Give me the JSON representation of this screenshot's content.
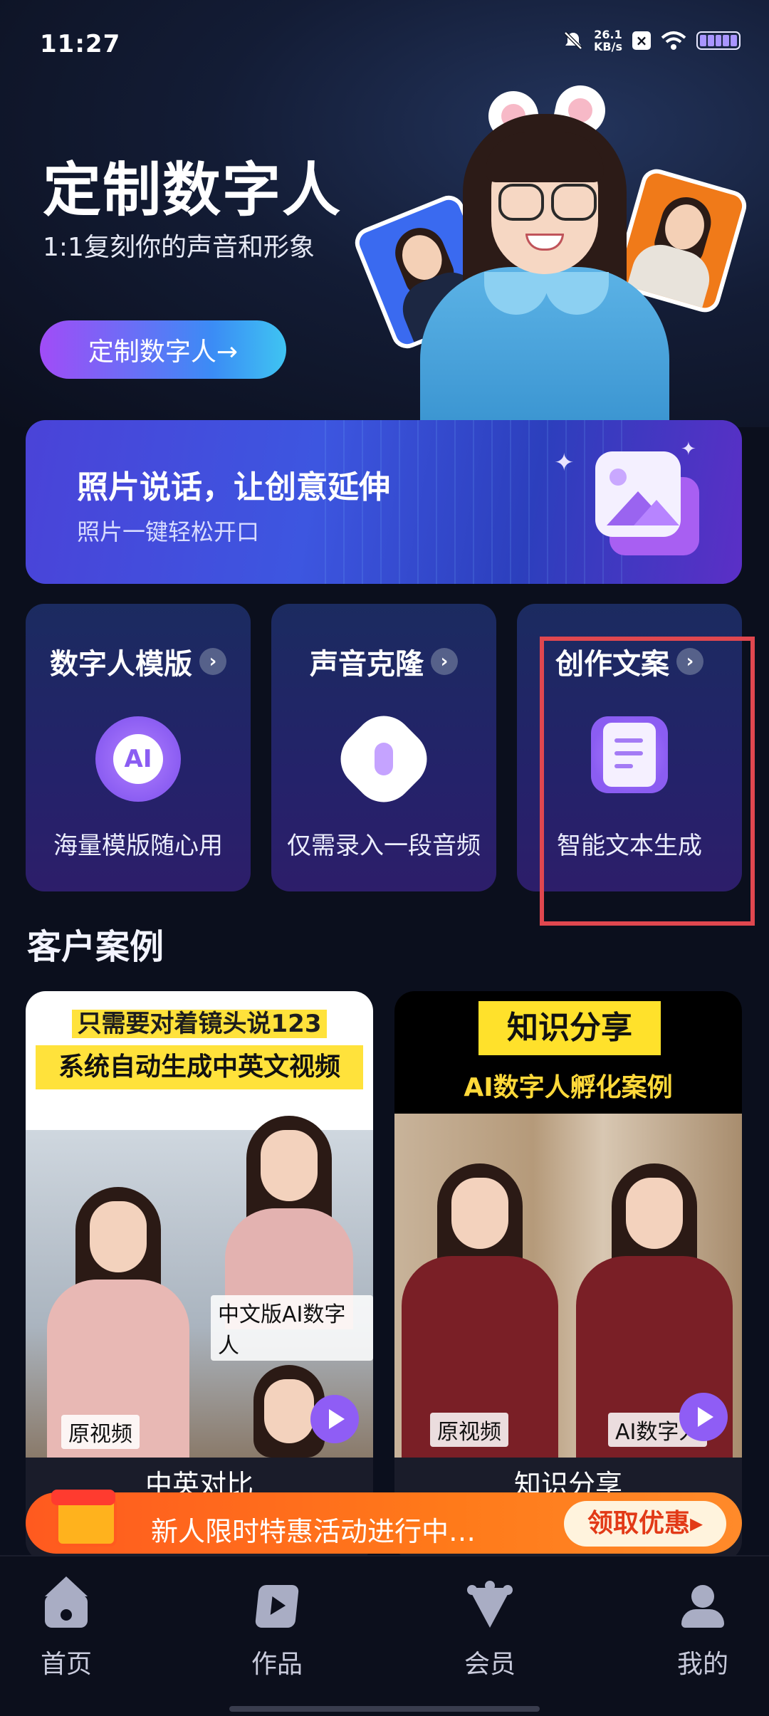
{
  "status_bar": {
    "time": "11:27",
    "network_speed_value": "26.1",
    "network_speed_unit": "KB/s",
    "icons": [
      "mute-bell-icon",
      "close-box-icon",
      "wifi-icon",
      "battery-icon"
    ]
  },
  "hero": {
    "title": "定制数字人",
    "subtitle": "1:1复刻你的声音和形象",
    "button_label": "定制数字人→"
  },
  "banner": {
    "title": "照片说话，让创意延伸",
    "subtitle": "照片一键轻松开口",
    "icon": "image-icon"
  },
  "features": [
    {
      "title": "数字人模版",
      "description": "海量模版随心用",
      "icon": "ai-head-icon"
    },
    {
      "title": "声音克隆",
      "description": "仅需录入一段音频",
      "icon": "microphone-icon"
    },
    {
      "title": "创作文案",
      "description": "智能文本生成",
      "icon": "document-icon"
    }
  ],
  "cases": {
    "section_title": "客户案例",
    "items": [
      {
        "headline_1": "只需要对着镜头说123",
        "headline_2": "系统自动生成中英文视频",
        "tag_top": "中文版AI数字人",
        "tag_bottom": "原视频",
        "caption": "中英对比"
      },
      {
        "headline_1": "知识分享",
        "headline_2": "AI数字人孵化案例",
        "tag_left": "原视频",
        "tag_right": "AI数字人",
        "caption": "知识分享"
      }
    ]
  },
  "promo": {
    "text": "新人限时特惠活动进行中…",
    "button_label": "领取优惠▸"
  },
  "bottom_nav": [
    {
      "label": "首页",
      "icon": "home-icon"
    },
    {
      "label": "作品",
      "icon": "works-icon"
    },
    {
      "label": "会员",
      "icon": "vip-crown-icon"
    },
    {
      "label": "我的",
      "icon": "profile-icon"
    }
  ],
  "colors": {
    "background": "#0b0f1d",
    "accent_purple": "#8b5df2",
    "promo_orange": "#ff6a1f",
    "highlight_red": "#e0474f"
  }
}
